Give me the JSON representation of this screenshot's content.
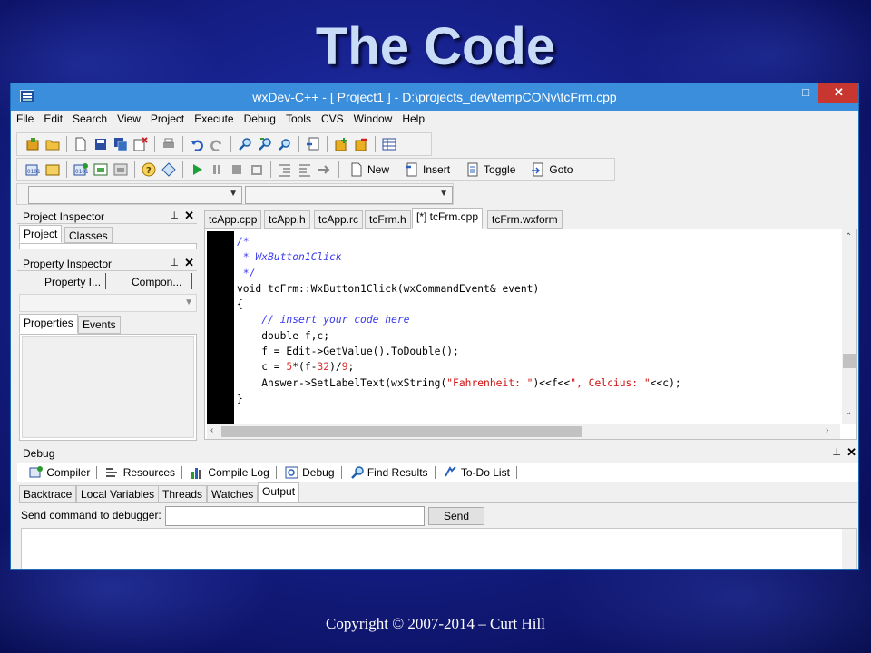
{
  "slide": {
    "title": "The Code",
    "footer": "Copyright ©  2007-2014 – Curt Hill"
  },
  "window": {
    "title": "wxDev-C++  - [ Project1 ] - D:\\projects_dev\\tempCONv\\tcFrm.cpp",
    "minimize": "–",
    "maximize": "□",
    "close": "✕"
  },
  "menu": [
    "File",
    "Edit",
    "Search",
    "View",
    "Project",
    "Execute",
    "Debug",
    "Tools",
    "CVS",
    "Window",
    "Help"
  ],
  "toolbar2_buttons": {
    "new": "New",
    "insert": "Insert",
    "toggle": "Toggle",
    "goto": "Goto"
  },
  "project_inspector": {
    "title": "Project Inspector",
    "pin": "⊥",
    "close": "✕",
    "tabs": [
      "Project",
      "Classes"
    ]
  },
  "property_inspector": {
    "title": "Property Inspector",
    "pin": "⊥",
    "close": "✕",
    "col_property": "Property I...",
    "col_component": "Compon...",
    "tabs": [
      "Properties",
      "Events"
    ]
  },
  "editor": {
    "tabs": [
      "tcApp.cpp",
      "tcApp.h",
      "tcApp.rc",
      "tcFrm.h",
      "[*] tcFrm.cpp",
      "tcFrm.wxform"
    ],
    "code": {
      "l1": "/*",
      "l2": " * WxButton1Click",
      "l3": " */",
      "l4": "void tcFrm::WxButton1Click(wxCommandEvent& event)",
      "l5": "{",
      "l6": "    // insert your code here",
      "l7": "    double f,c;",
      "l8": "    f = Edit->GetValue().ToDouble();",
      "l9a": "    c = ",
      "l9b": "5",
      "l9c": "*(f-",
      "l9d": "32",
      "l9e": ")/",
      "l9f": "9",
      "l9g": ";",
      "l10a": "    Answer->SetLabelText(wxString(",
      "l10b": "\"Fahrenheit: \"",
      "l10c": ")<<f<<",
      "l10d": "\", Celcius: \"",
      "l10e": "<<c);",
      "l11": "}"
    }
  },
  "debug": {
    "title": "Debug",
    "pin": "⊥",
    "close": "✕",
    "tabs": [
      "Compiler",
      "Resources",
      "Compile Log",
      "Debug",
      "Find Results",
      "To-Do List"
    ],
    "subtabs": [
      "Backtrace",
      "Local Variables",
      "Threads",
      "Watches",
      "Output"
    ],
    "send_label": "Send command to debugger:",
    "send_input": "",
    "send_button": "Send"
  },
  "colors": {
    "titlebar": "#3b8edb",
    "close_button": "#c7372f",
    "comment": "#3a3af0",
    "string": "#d01010"
  }
}
